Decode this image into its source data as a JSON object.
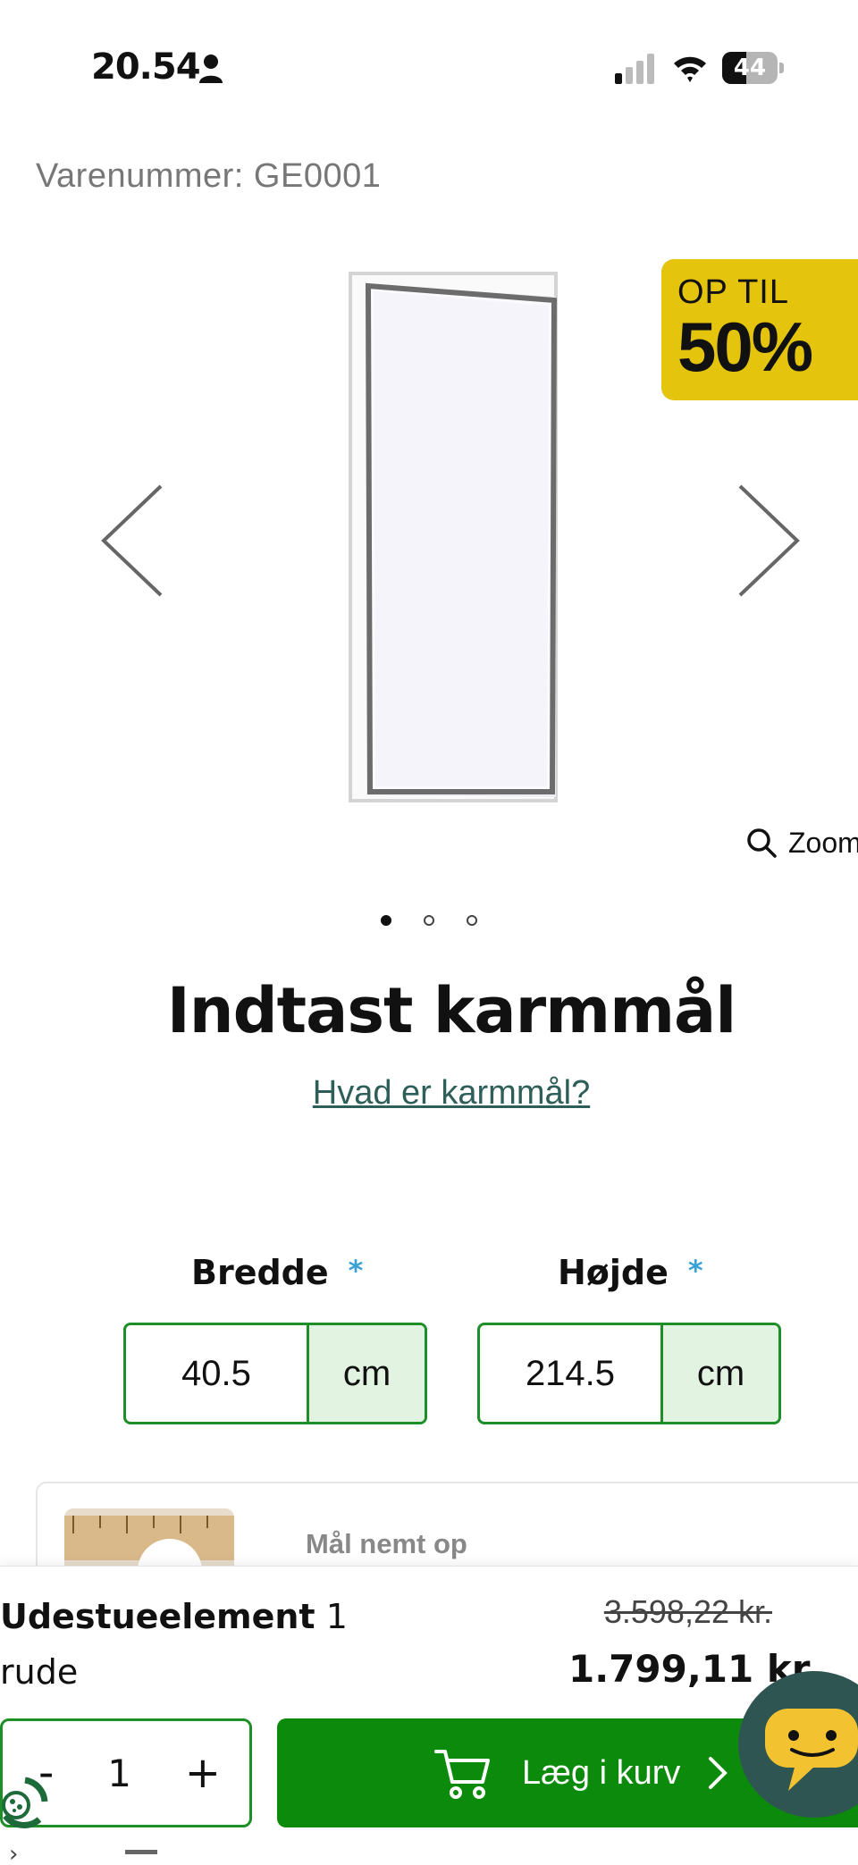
{
  "status_bar": {
    "time": "20.54",
    "battery": "44",
    "battery_level": 0.44,
    "icons": [
      "person-icon",
      "signal-icon",
      "wifi-icon",
      "battery-icon"
    ]
  },
  "product": {
    "sku": "Varenummer: GE0001",
    "badge_top": "OP TIL",
    "badge_big": "50%",
    "zoom_label": "Zoom",
    "gallery_pages": 3,
    "gallery_active": 1
  },
  "configurator": {
    "heading": "Indtast karmmål",
    "help_link": "Hvad er karmmål?",
    "width_label": "Bredde",
    "height_label": "Højde",
    "required_mark": "*",
    "width_value": "40.5",
    "height_value": "214.5",
    "unit": "cm"
  },
  "measure_card": {
    "title": "Mål nemt op"
  },
  "bottom_bar": {
    "product_name": "Udestueelement",
    "product_name_suffix": " 1",
    "product_sub": "rude",
    "old_price": "3.598,22 kr.",
    "new_price": "1.799,11 kr.",
    "qty_minus": "-",
    "qty_value": "1",
    "qty_plus": "+",
    "add_to_cart": "Læg i kurv"
  },
  "colors": {
    "accent_green": "#0b8a0b",
    "border_green": "#1e8f28",
    "badge_yellow": "#e4c40c",
    "link_teal": "#2d5e57",
    "chat_dark": "#2f5553"
  }
}
